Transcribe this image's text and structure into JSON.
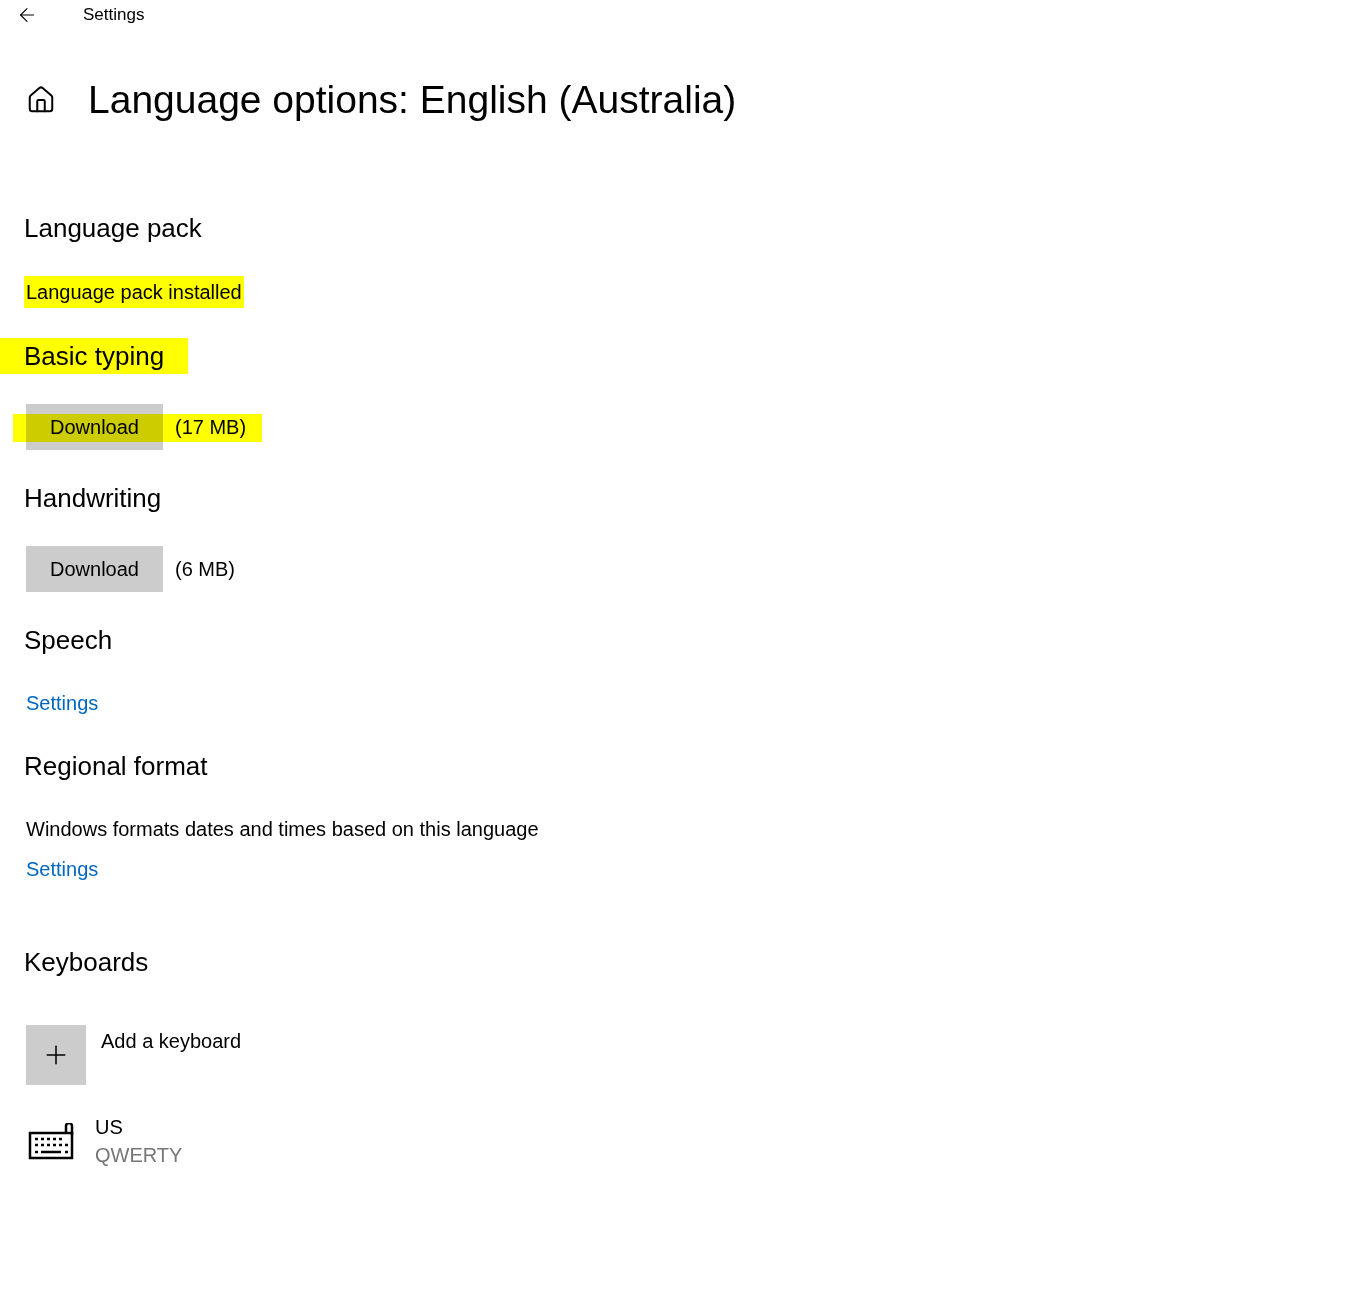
{
  "window": {
    "title": "Settings"
  },
  "page_title": "Language options: English (Australia)",
  "sections": [
    {
      "heading": "Language pack",
      "highlighted": false,
      "items": [
        {
          "kind": "status",
          "text": "Language pack installed",
          "highlighted": true
        }
      ]
    },
    {
      "heading": "Basic typing",
      "highlighted": true,
      "items": [
        {
          "kind": "download",
          "button": "Download",
          "size": "(17 MB)",
          "highlighted": true
        }
      ]
    },
    {
      "heading": "Handwriting",
      "highlighted": false,
      "items": [
        {
          "kind": "download",
          "button": "Download",
          "size": "(6 MB)",
          "highlighted": false
        }
      ]
    },
    {
      "heading": "Speech",
      "highlighted": false,
      "items": [
        {
          "kind": "link",
          "text": "Settings"
        }
      ]
    },
    {
      "heading": "Regional format",
      "highlighted": false,
      "items": [
        {
          "kind": "text",
          "text": "Windows formats dates and times based on this language"
        },
        {
          "kind": "link",
          "text": "Settings"
        }
      ]
    },
    {
      "heading": "Keyboards",
      "highlighted": false,
      "items": [
        {
          "kind": "add",
          "text": "Add a keyboard"
        },
        {
          "kind": "keyboard",
          "name": "US",
          "layout": "QWERTY"
        }
      ]
    }
  ]
}
